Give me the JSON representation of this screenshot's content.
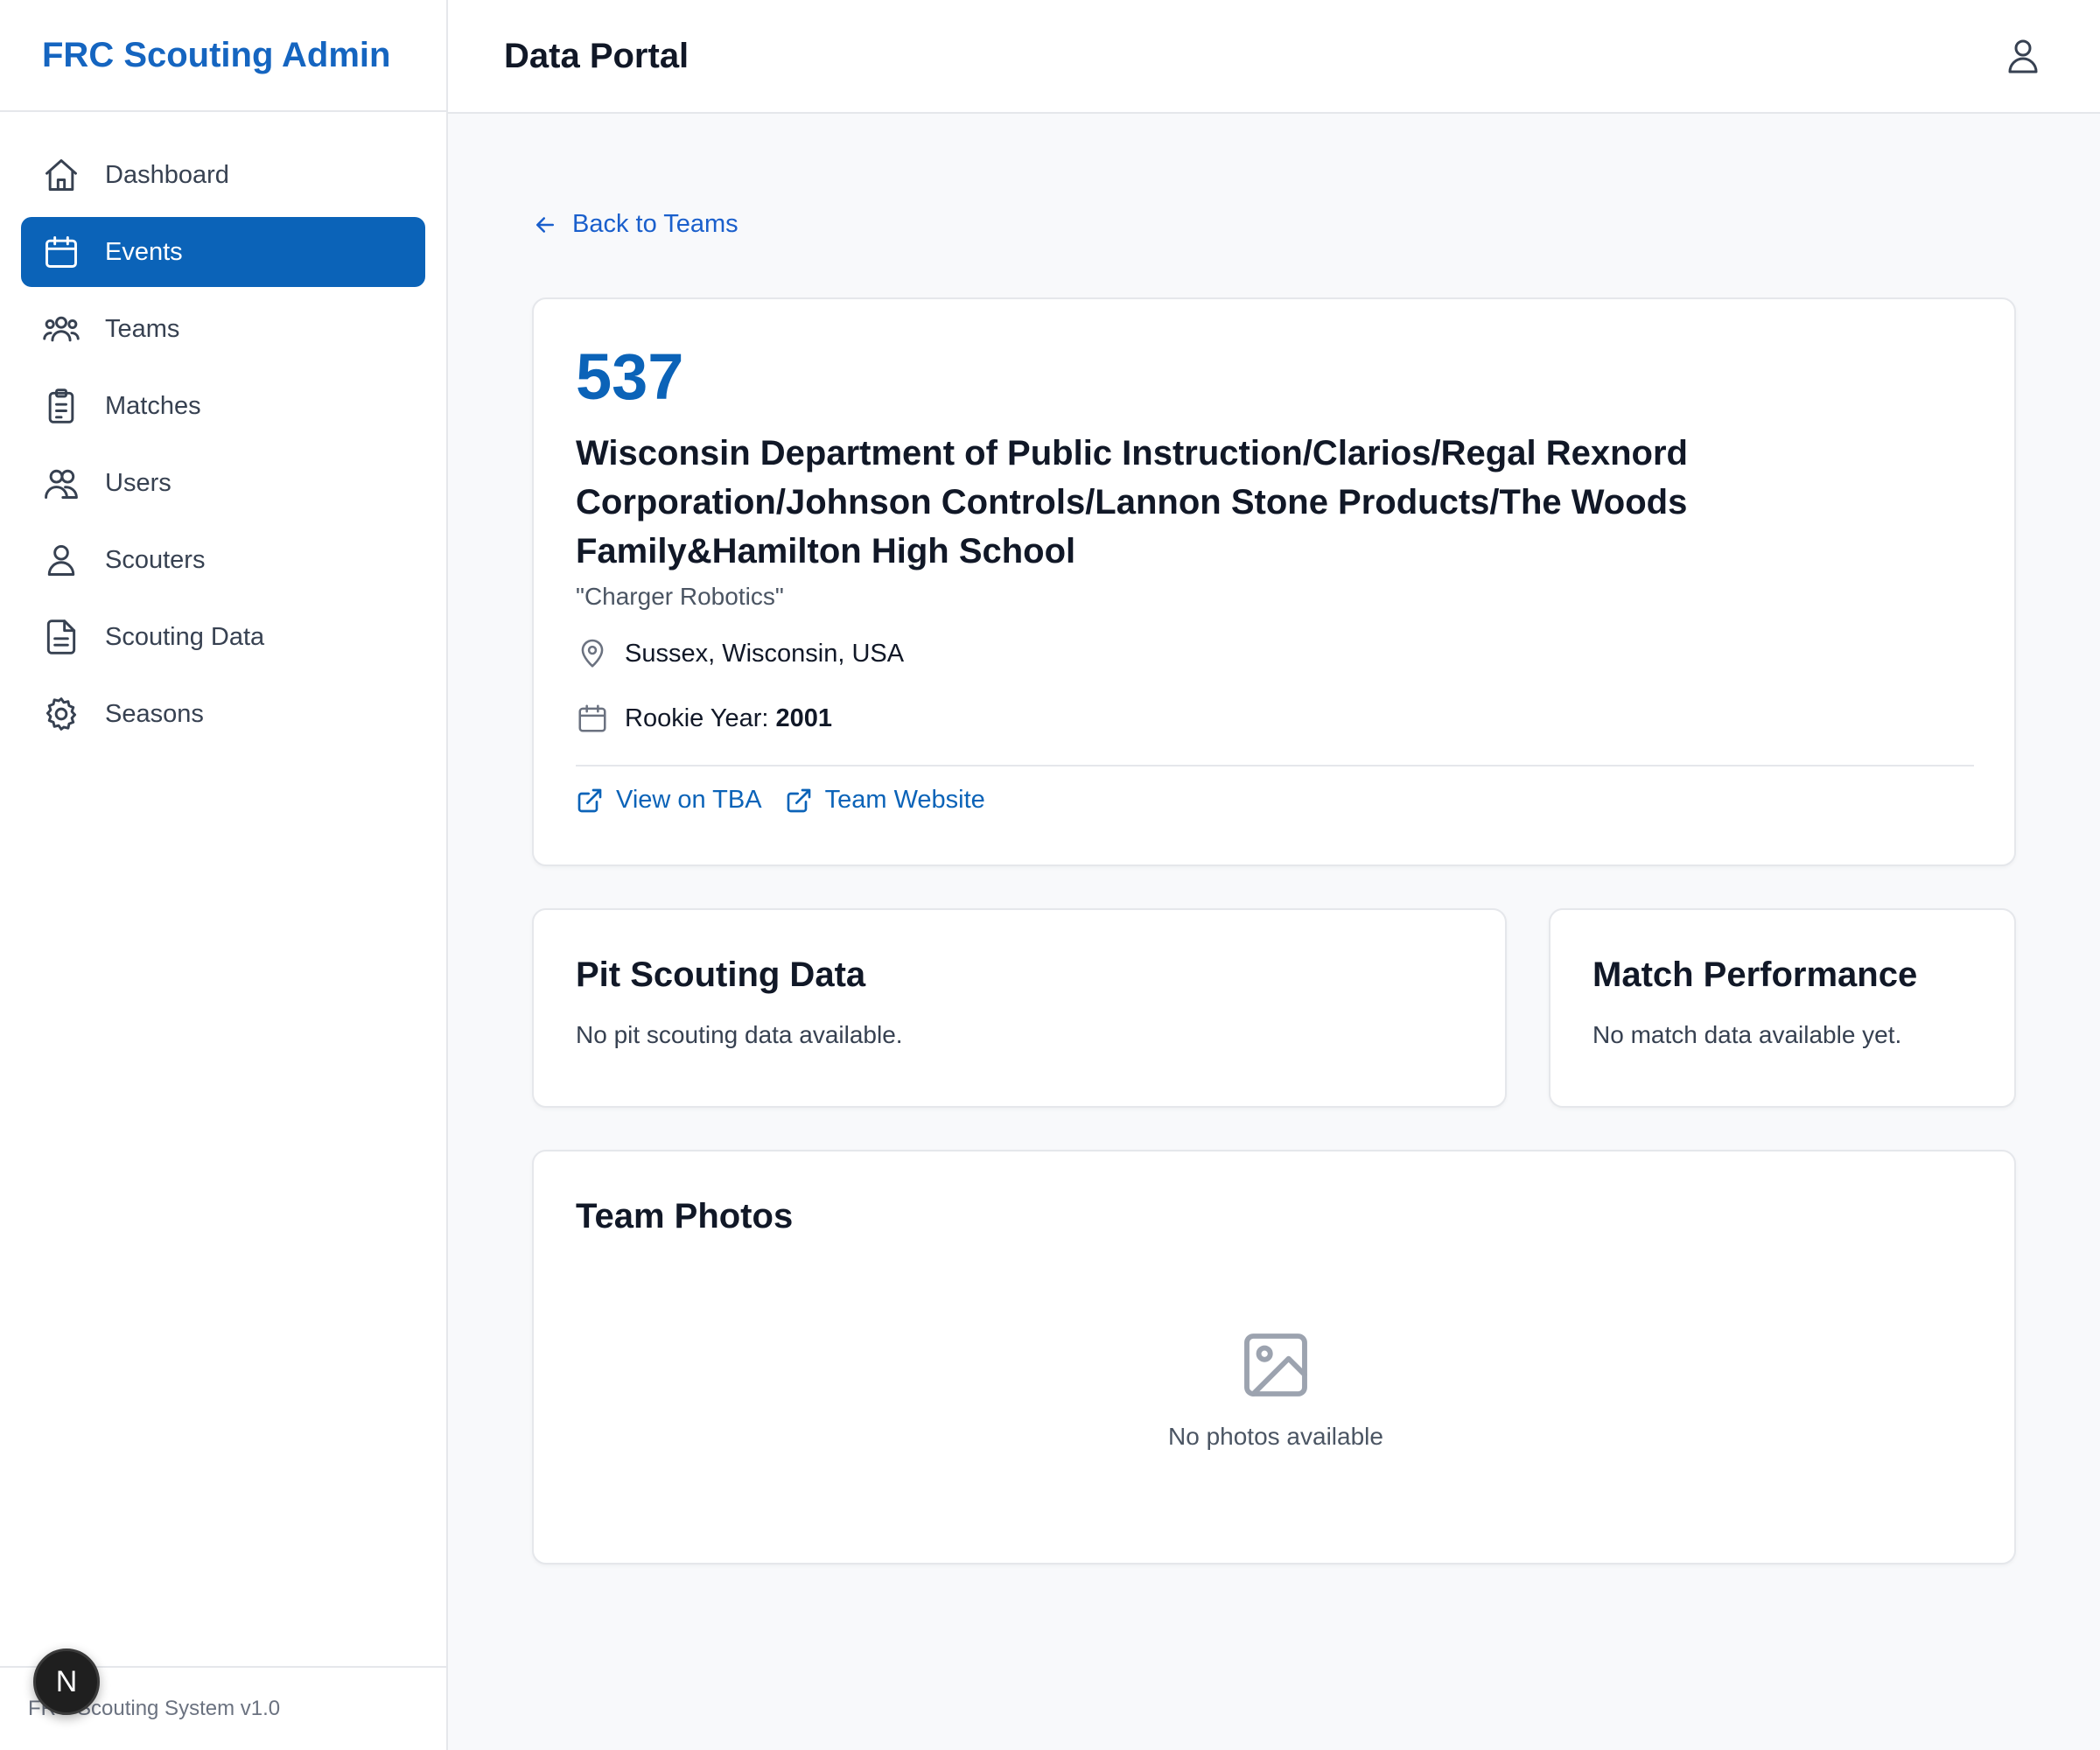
{
  "app": {
    "brand": "FRC Scouting Admin",
    "footer": "FRC Scouting System v1.0",
    "n_badge": "N"
  },
  "sidebar": {
    "items": [
      {
        "label": "Dashboard",
        "icon": "home-icon",
        "active": false
      },
      {
        "label": "Events",
        "icon": "calendar-icon",
        "active": true
      },
      {
        "label": "Teams",
        "icon": "users-group-icon",
        "active": false
      },
      {
        "label": "Matches",
        "icon": "clipboard-icon",
        "active": false
      },
      {
        "label": "Users",
        "icon": "users-icon",
        "active": false
      },
      {
        "label": "Scouters",
        "icon": "user-icon",
        "active": false
      },
      {
        "label": "Scouting Data",
        "icon": "document-icon",
        "active": false
      },
      {
        "label": "Seasons",
        "icon": "gear-icon",
        "active": false
      }
    ]
  },
  "header": {
    "title": "Data Portal",
    "user_icon": "user-icon"
  },
  "main": {
    "back_label": "Back to Teams",
    "team": {
      "number": "537",
      "name": "Wisconsin Department of Public Instruction/Clarios/Regal Rexnord Corporation/Johnson Controls/Lannon Stone Products/The Woods Family&Hamilton High School",
      "nickname": "\"Charger Robotics\"",
      "location": "Sussex, Wisconsin, USA",
      "rookie_label": "Rookie Year:",
      "rookie_year": "2001",
      "links": {
        "tba": "View on TBA",
        "website": "Team Website"
      }
    },
    "pit": {
      "title": "Pit Scouting Data",
      "empty": "No pit scouting data available."
    },
    "match": {
      "title": "Match Performance",
      "empty": "No match data available yet."
    },
    "photos": {
      "title": "Team Photos",
      "empty": "No photos available"
    }
  },
  "colors": {
    "accent": "#0b63b8",
    "link": "#1a5fcc",
    "text": "#111827",
    "muted": "#4b5563"
  }
}
